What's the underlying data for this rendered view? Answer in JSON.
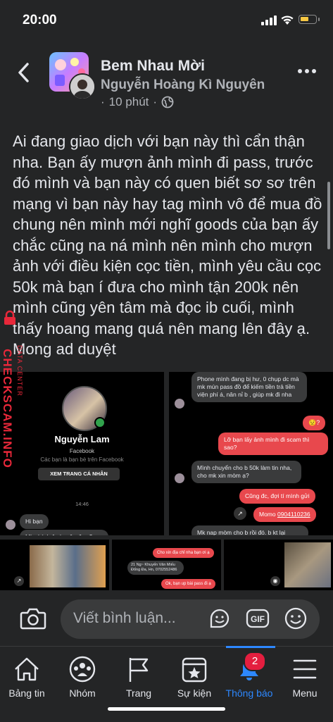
{
  "status_bar": {
    "time": "20:00"
  },
  "header": {
    "group_name": "Bem Nhau Mời",
    "author": "Nguyễn Hoàng Kì Nguyên",
    "time_ago": "10 phút",
    "separator": "·"
  },
  "post": {
    "text": "Ai đang giao dịch với bạn này thì cẩn thận nha. Bạn ấy mượn ảnh mình đi pass, trước đó mình và bạn này có quen biết sơ sơ trên mạng vì bạn này hay tag mình vô để mua đồ chung nên mình mới nghĩ goods của bạn ấy chắc cũng na ná mình nên mình cho mượn ảnh với điều kiện cọc tiền, mình yêu cầu cọc 50k mà bạn í đưa cho mình tận 200k nên mình cũng yên tâm mà đọc ib cuối, mình thấy hoang mang quá nên mang lên đây ạ. Mong ad duyệt"
  },
  "watermark": {
    "brand": "CHECKSCAM.INFO",
    "sub": "DATA CENTER"
  },
  "screenshot_left": {
    "profile_name": "Nguyễn Lam",
    "profile_platform": "Facebook",
    "not_friends": "Các bạn là bạn bè trên Facebook",
    "view_profile": "XEM TRANG CÁ NHÂN",
    "time": "14:46",
    "msg1": "Hi bạn",
    "msg2": "Mk chờ b 1 chuyện đc ạ?"
  },
  "screenshot_right": {
    "msg1": "Phone mình đang bị hư, 0 chụp dc mà mk mún pass đồ để kiếm tiền trả tiền viện phí á, nân nỉ b , giúp mk đi nha",
    "emoji": "😟?",
    "msg2": "Lỡ bạn lấy ảnh mình đi scam thì sao?",
    "msg3": "Mình chuyển cho b 50k làm tin nha, cho mk xin mòm ạ?",
    "msg4": "Cũng đc, đợi tí mình gửi",
    "momo_label": "Momo ",
    "momo_number": "0904110236",
    "msg5": "Mk nap mòm cho b rồi đó. b kt lại"
  },
  "screenshot_mid": {
    "msg1": "Cho xin địa chỉ nha bạn ơi ạ",
    "addr": "21 Ng~ Khuyến Văn Miếu Đống Đa, Hn, 0702552486",
    "msg2": "Ok, bạn up bài pass đi ạ"
  },
  "composer": {
    "placeholder": "Viết bình luận..."
  },
  "tabs": [
    {
      "label": "Bảng tin",
      "icon": "home-icon"
    },
    {
      "label": "Nhóm",
      "icon": "groups-icon"
    },
    {
      "label": "Trang",
      "icon": "flag-icon"
    },
    {
      "label": "Sự kiện",
      "icon": "calendar-star-icon"
    },
    {
      "label": "Thông báo",
      "icon": "bell-icon",
      "badge": "2",
      "active": true
    },
    {
      "label": "Menu",
      "icon": "hamburger-icon"
    }
  ],
  "colors": {
    "accent": "#2d88ff",
    "badge": "#e41e3f",
    "watermark": "#e8283a",
    "bubble_sent": "#e8484d"
  }
}
